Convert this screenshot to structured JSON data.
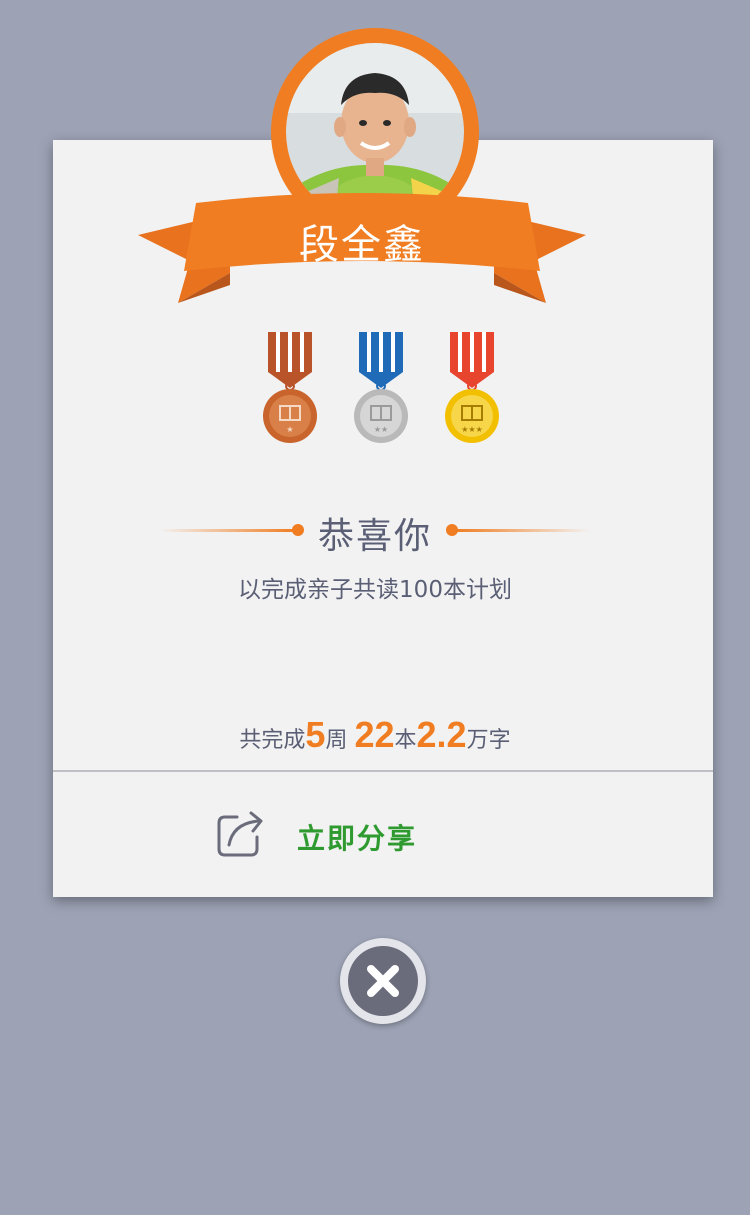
{
  "profile": {
    "name": "段全鑫",
    "avatar_icon": "child-portrait-avatar"
  },
  "medals": [
    {
      "name": "bronze-medal",
      "color": "#c9652c",
      "ribbon": "#b9542a"
    },
    {
      "name": "silver-medal",
      "color": "#c8c8c8",
      "ribbon": "#1f6bb8"
    },
    {
      "name": "gold-medal",
      "color": "#f2c000",
      "ribbon": "#e8452f"
    }
  ],
  "congrats": {
    "title": "恭喜你",
    "subtitle": "以完成亲子共读100本计划"
  },
  "stats": {
    "prefix": "共完成",
    "weeks_value": "5",
    "weeks_unit": "周",
    "books_value": "22",
    "books_unit": "本",
    "words_value": "2.2",
    "words_unit": "万字"
  },
  "share": {
    "label": "立即分享",
    "icon": "share-icon"
  },
  "close": {
    "icon": "close-icon"
  },
  "colors": {
    "accent": "#f07d21",
    "background": "#9da3b5",
    "card": "#f2f2f2",
    "share_text": "#2f9a2f",
    "body_text": "#5a5f75"
  }
}
